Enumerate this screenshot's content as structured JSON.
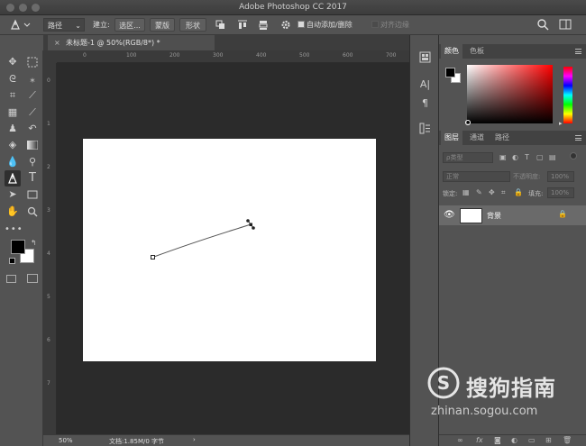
{
  "app": {
    "title": "Adobe Photoshop CC 2017"
  },
  "options_bar": {
    "mode_value": "路径",
    "build_label": "建立:",
    "selection_button": "选区...",
    "mask_button": "蒙版",
    "shape_button": "形状",
    "auto_add_delete_label": "自动添加/删除",
    "align_edges_label": "对齐边缘"
  },
  "document": {
    "tab_title": "未标题-1 @ 50%(RGB/8*) *",
    "close_glyph": "×",
    "zoom": "50%",
    "status_text": "文档:1.85M/0 字节",
    "status_arrow": "›"
  },
  "rulers": {
    "horizontal_ticks": [
      "0",
      "100",
      "200",
      "300",
      "400",
      "500",
      "600",
      "700",
      "800"
    ],
    "vertical_ticks": [
      "0",
      "1",
      "2",
      "3",
      "4",
      "5",
      "6",
      "7"
    ]
  },
  "color_panel": {
    "tabs": [
      "颜色",
      "色板"
    ],
    "foreground": "#000000",
    "background": "#ffffff"
  },
  "layers_panel": {
    "tabs": [
      "图层",
      "通道",
      "路径"
    ],
    "filter_placeholder": "ρ类型",
    "blend_mode": "正常",
    "opacity_label": "不透明度:",
    "opacity_value": "100%",
    "lock_label": "锁定:",
    "fill_label": "填充:",
    "fill_value": "100%",
    "layers": [
      {
        "name": "背景",
        "visible": true,
        "locked": true
      }
    ]
  },
  "watermark": {
    "text": "搜狗指南",
    "url": "zhinan.sogou.com"
  },
  "colors": {
    "ui_dark": "#535353",
    "pasteboard": "#2b2b2b",
    "canvas": "#ffffff",
    "selected_layer": "#6a6a6a"
  }
}
